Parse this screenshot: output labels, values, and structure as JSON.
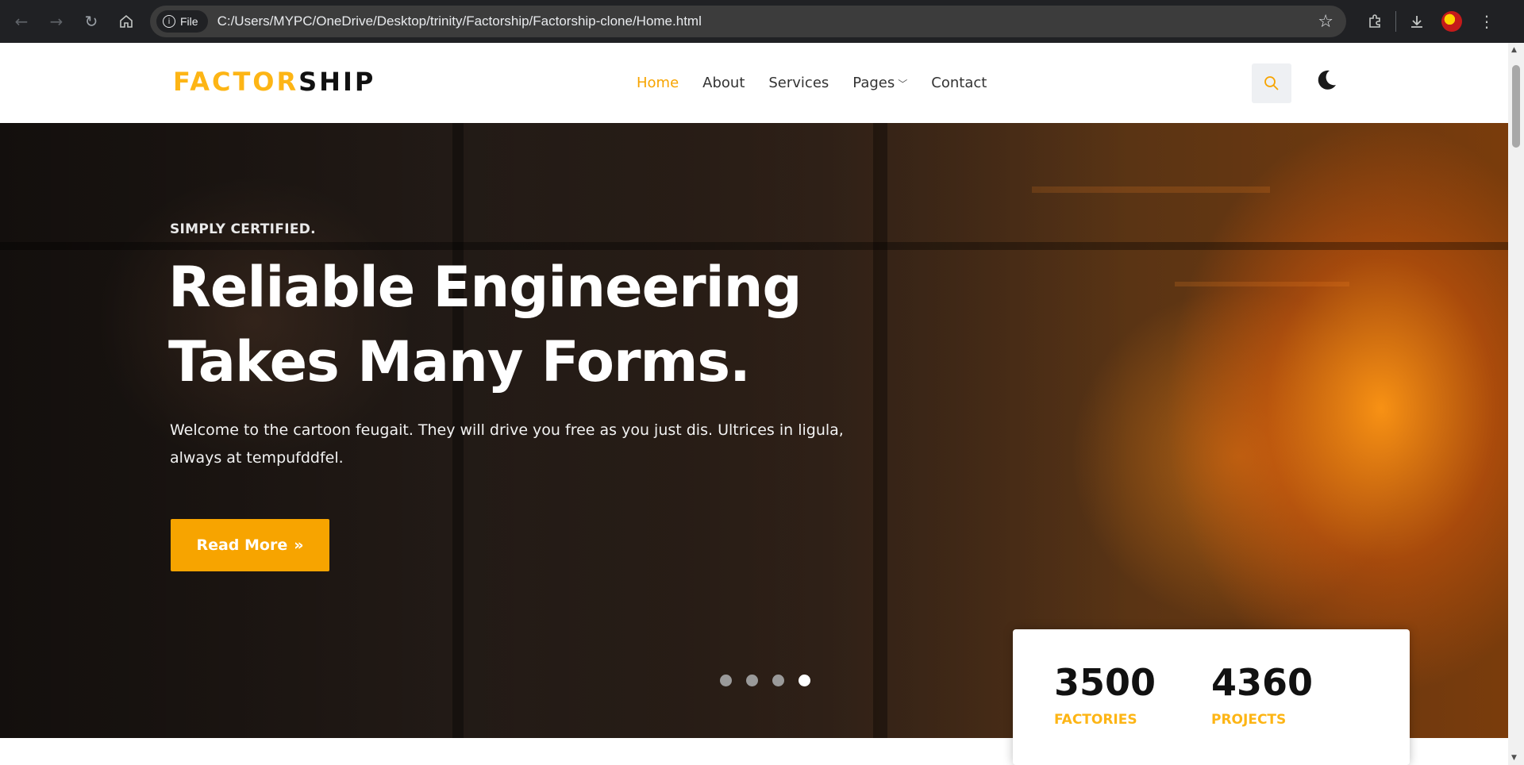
{
  "browser": {
    "file_chip": "File",
    "url": "C:/Users/MYPC/OneDrive/Desktop/trinity/Factorship/Factorship-clone/Home.html"
  },
  "header": {
    "logo_part1": "FACTOR",
    "logo_part2": "SHIP",
    "nav": [
      "Home",
      "About",
      "Services",
      "Pages",
      "Contact"
    ],
    "active_index": 0
  },
  "hero": {
    "eyebrow": "SIMPLY CERTIFIED.",
    "headline_line1": "Reliable Engineering",
    "headline_line2": "Takes Many Forms.",
    "lead": "Welcome to the cartoon feugait. They will drive you free as you just dis. Ultrices in ligula, always at tempufddfel.",
    "button_label": "Read More",
    "slides_total": 4,
    "slide_active": 4
  },
  "stats": [
    {
      "value": "3500",
      "label": "FACTORIES"
    },
    {
      "value": "4360",
      "label": "PROJECTS"
    }
  ],
  "colors": {
    "brand": "#fdb515",
    "accent": "#f7a400",
    "chrome": "#202124"
  },
  "icons": {
    "back": "back-arrow-icon",
    "forward": "forward-arrow-icon",
    "reload": "reload-icon",
    "home": "home-icon",
    "star": "star-icon",
    "extensions": "puzzle-icon",
    "downloads": "download-icon",
    "menu": "kebab-menu-icon",
    "search": "search-icon",
    "theme": "moon-icon"
  }
}
